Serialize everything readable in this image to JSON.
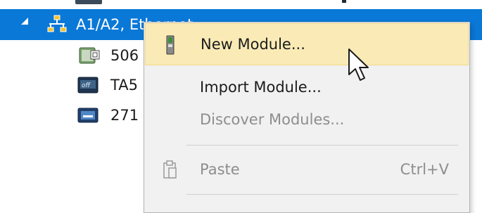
{
  "tree": {
    "selected_node": {
      "label": "A1/A2, Ethernet",
      "icon": "ethernet-network-icon"
    },
    "children": [
      {
        "label": "506",
        "icon": "io-module-icon"
      },
      {
        "label": "TA5",
        "icon": "device-card-icon"
      },
      {
        "label": "271",
        "icon": "hmi-panel-icon"
      }
    ]
  },
  "context_menu": {
    "items": [
      {
        "label": "New Module...",
        "icon": "module-icon",
        "enabled": true,
        "hovered": true
      },
      {
        "label": "Import Module...",
        "enabled": true
      },
      {
        "label": "Discover Modules...",
        "enabled": false
      },
      {
        "label": "Paste",
        "shortcut": "Ctrl+V",
        "icon": "paste-icon",
        "enabled": false
      }
    ]
  },
  "colors": {
    "selection": "#0a78d7",
    "menu_background": "#f1f1f1",
    "menu_hover": "#faebb6",
    "disabled_text": "#8d8d8d"
  }
}
